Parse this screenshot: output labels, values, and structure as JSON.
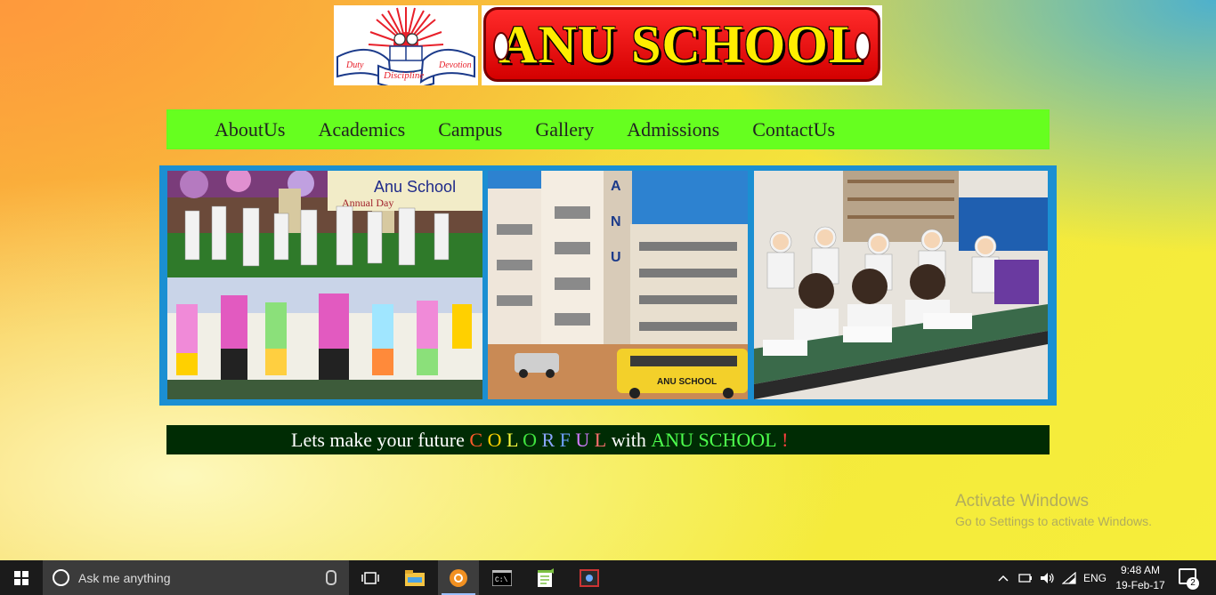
{
  "header": {
    "logo_words": [
      "Duty",
      "Discipline",
      "Devotion"
    ],
    "banner_title": "ANU SCHOOL"
  },
  "nav": {
    "items": [
      "AboutUs",
      "Academics",
      "Campus",
      "Gallery",
      "Admissions",
      "ContactUs"
    ]
  },
  "photos": {
    "annual_day_sign": "Anu School",
    "annual_day_sub": "Annual Day",
    "bus_label": "ANU SCHOOL",
    "building_letters": [
      "A",
      "N",
      "U"
    ]
  },
  "tagline": {
    "prefix": "Lets make your future",
    "letters": [
      {
        "ch": "C",
        "color": "#ff5a2a"
      },
      {
        "ch": "O",
        "color": "#ffd000"
      },
      {
        "ch": "L",
        "color": "#ffff40"
      },
      {
        "ch": "O",
        "color": "#3fe23f"
      },
      {
        "ch": "R",
        "color": "#8aa6ff"
      },
      {
        "ch": "F",
        "color": "#6fa0ff"
      },
      {
        "ch": "U",
        "color": "#d27bff"
      },
      {
        "ch": "L",
        "color": "#ff6f6f"
      }
    ],
    "with_text": "with",
    "school": "ANU SCHOOL",
    "school_color": "#4dff4d",
    "exclaim": "!",
    "exclaim_color": "#ff4040"
  },
  "watermark": {
    "line1": "Activate Windows",
    "line2": "Go to Settings to activate Windows."
  },
  "taskbar": {
    "search_placeholder": "Ask me anything",
    "language": "ENG",
    "time": "9:48 AM",
    "date": "19-Feb-17",
    "notification_count": "2"
  }
}
